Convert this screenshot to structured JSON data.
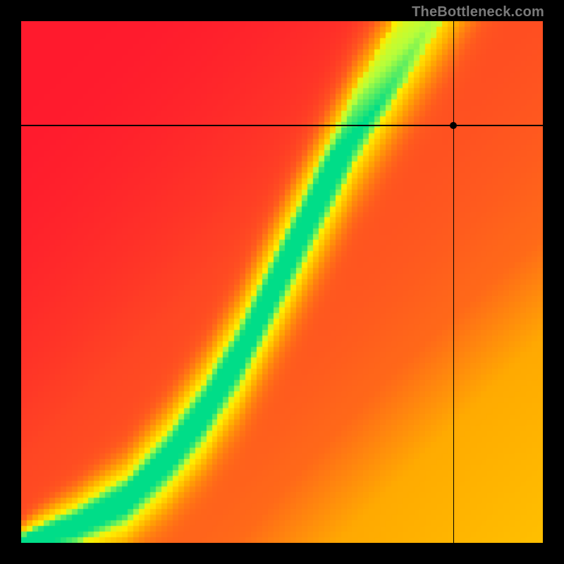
{
  "watermark": "TheBottleneck.com",
  "chart_data": {
    "type": "heatmap",
    "title": "",
    "xlabel": "",
    "ylabel": "",
    "xlim": [
      0,
      1
    ],
    "ylim": [
      0,
      1
    ],
    "grid": false,
    "legend": false,
    "marker": {
      "x": 0.83,
      "y": 0.8,
      "note": "crosshair intersection point"
    },
    "ridge_curve_note": "optimal curve y(x): below are approximate (x,y) control points of the bright green ridge",
    "ridge_curve": [
      {
        "x": 0.0,
        "y": 0.0
      },
      {
        "x": 0.1,
        "y": 0.03
      },
      {
        "x": 0.2,
        "y": 0.08
      },
      {
        "x": 0.28,
        "y": 0.16
      },
      {
        "x": 0.35,
        "y": 0.25
      },
      {
        "x": 0.42,
        "y": 0.36
      },
      {
        "x": 0.48,
        "y": 0.48
      },
      {
        "x": 0.54,
        "y": 0.6
      },
      {
        "x": 0.59,
        "y": 0.7
      },
      {
        "x": 0.64,
        "y": 0.8
      },
      {
        "x": 0.7,
        "y": 0.9
      },
      {
        "x": 0.76,
        "y": 1.0
      }
    ],
    "colormap_note": "value 0..1 mapped across red→orange→yellow→green",
    "colormap": [
      {
        "t": 0.0,
        "color": "#ff1a2e"
      },
      {
        "t": 0.3,
        "color": "#ff5a1f"
      },
      {
        "t": 0.55,
        "color": "#ffb000"
      },
      {
        "t": 0.75,
        "color": "#fff000"
      },
      {
        "t": 0.9,
        "color": "#b8ff3c"
      },
      {
        "t": 1.0,
        "color": "#00dd88"
      }
    ],
    "falloff_note": "heat value = gaussian of distance from ridge; sigma varies with x",
    "sigma": {
      "min": 0.018,
      "max": 0.11
    },
    "corner_boost_note": "bottom-right corner gets a warm boost; top-left coldest",
    "corner_boost": 0.55
  },
  "icons": {
    "marker": "marker-dot"
  }
}
